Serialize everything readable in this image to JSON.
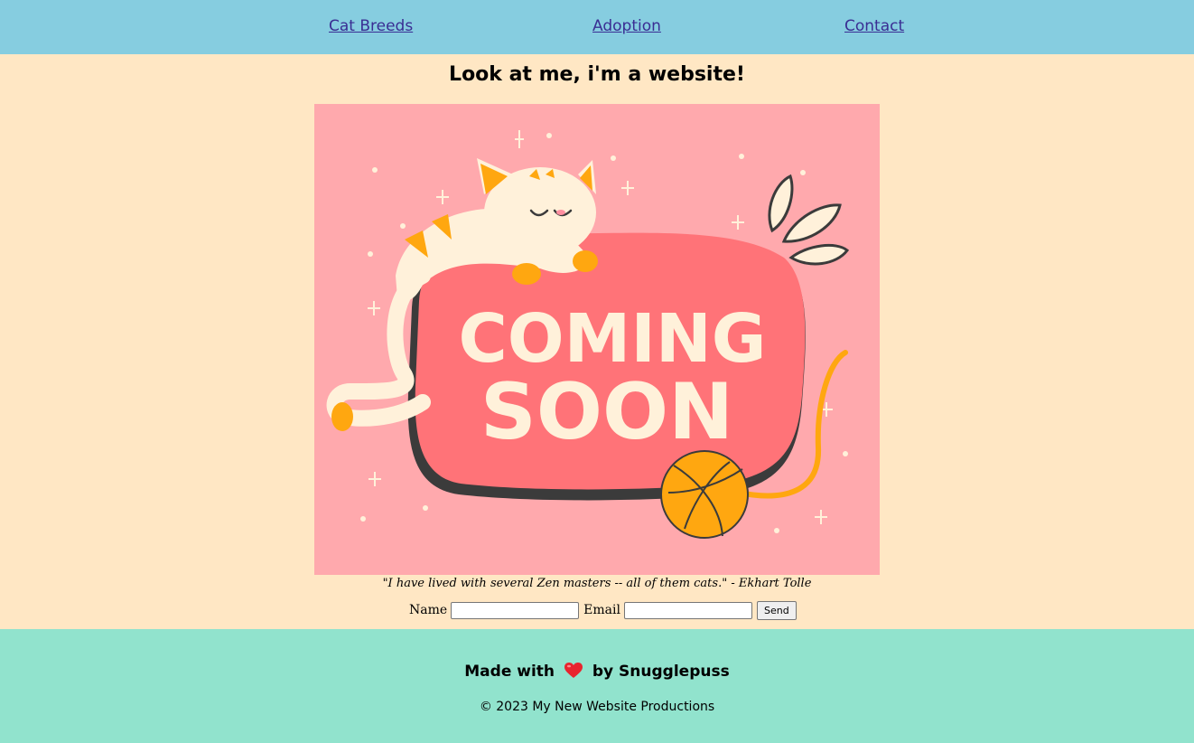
{
  "nav": {
    "items": [
      {
        "label": "Cat Breeds"
      },
      {
        "label": "Adoption"
      },
      {
        "label": "Contact"
      }
    ]
  },
  "main": {
    "title": "Look at me, i'm a website!",
    "hero": {
      "line1": "COMING",
      "line2": "SOON"
    },
    "quote": "\"I have lived with several Zen masters -- all of them cats.\" - Ekhart Tolle",
    "form": {
      "name_label": "Name",
      "name_value": "",
      "email_label": "Email",
      "email_value": "",
      "send_label": "Send"
    }
  },
  "footer": {
    "made_with_prefix": "Made with",
    "made_with_suffix": "by Snugglepuss",
    "copyright": "© 2023 My New Website Productions"
  },
  "colors": {
    "nav_bg": "#86CDE0",
    "page_bg": "#FFE7C4",
    "footer_bg": "#91E3CD",
    "link": "#3A2E93",
    "hero_bg": "#FFA9AD",
    "sign": "#FF7378",
    "cream": "#FFF1DA",
    "orange": "#FFA710"
  }
}
